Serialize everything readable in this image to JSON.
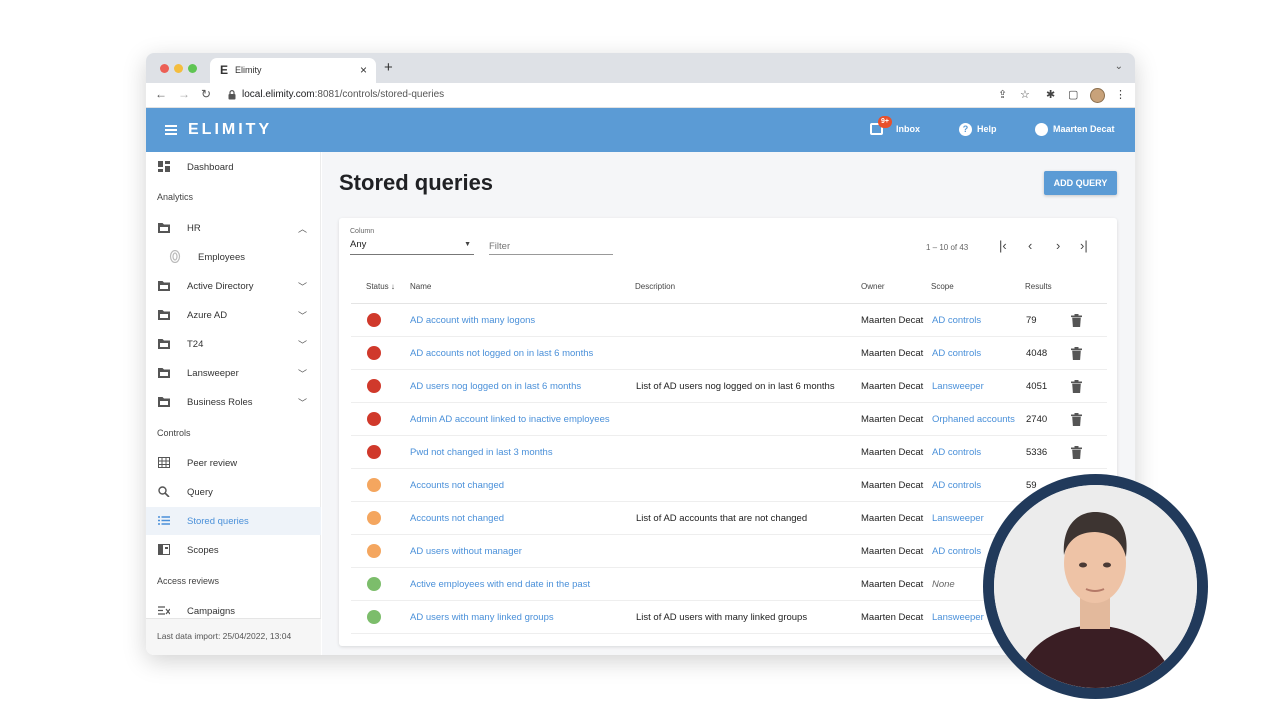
{
  "browser": {
    "tab_logo": "E",
    "tab_title": "Elimity",
    "tab_close": "×",
    "new_tab": "+",
    "tabs_menu": "⌄",
    "url_host": "local.elimity.com",
    "url_rest": ":8081/controls/stored-queries"
  },
  "appbar": {
    "brand": "ELIMITY",
    "inbox_badge": "9+",
    "inbox_label": "Inbox",
    "help_label": "Help",
    "user_label": "Maarten Decat"
  },
  "sidebar": {
    "dashboard": "Dashboard",
    "section_analytics": "Analytics",
    "hr": "HR",
    "employees": "Employees",
    "active_directory": "Active Directory",
    "azure_ad": "Azure AD",
    "t24": "T24",
    "lansweeper": "Lansweeper",
    "business_roles": "Business Roles",
    "section_controls": "Controls",
    "peer_review": "Peer review",
    "query": "Query",
    "stored_queries": "Stored queries",
    "scopes": "Scopes",
    "section_access_reviews": "Access reviews",
    "campaigns": "Campaigns",
    "footer": "Last data import: 25/04/2022, 13:04"
  },
  "main": {
    "title": "Stored queries",
    "add_button": "ADD QUERY",
    "column_label": "Column",
    "column_value": "Any",
    "filter_placeholder": "Filter",
    "pagination": "1 – 10 of 43"
  },
  "table": {
    "headers": {
      "status": "Status",
      "name": "Name",
      "description": "Description",
      "owner": "Owner",
      "scope": "Scope",
      "results": "Results"
    },
    "rows": [
      {
        "status_color": "#d0392b",
        "name": "AD account with many logons",
        "description": "",
        "owner": "Maarten Decat",
        "scope": "AD controls",
        "scope_none": false,
        "results": "79"
      },
      {
        "status_color": "#d0392b",
        "name": "AD accounts not logged on in last 6 months",
        "description": "",
        "owner": "Maarten Decat",
        "scope": "AD controls",
        "scope_none": false,
        "results": "4048"
      },
      {
        "status_color": "#d0392b",
        "name": "AD users nog logged on in last 6 months",
        "description": "List of AD users nog logged on in last 6 months",
        "owner": "Maarten Decat",
        "scope": "Lansweeper",
        "scope_none": false,
        "results": "4051"
      },
      {
        "status_color": "#d0392b",
        "name": "Admin AD account linked to inactive employees",
        "description": "",
        "owner": "Maarten Decat",
        "scope": "Orphaned accounts",
        "scope_none": false,
        "results": "2740"
      },
      {
        "status_color": "#d0392b",
        "name": "Pwd not changed in last 3 months",
        "description": "",
        "owner": "Maarten Decat",
        "scope": "AD controls",
        "scope_none": false,
        "results": "5336"
      },
      {
        "status_color": "#f4a65f",
        "name": "Accounts not changed",
        "description": "",
        "owner": "Maarten Decat",
        "scope": "AD controls",
        "scope_none": false,
        "results": "59"
      },
      {
        "status_color": "#f4a65f",
        "name": "Accounts not changed",
        "description": "List of AD accounts that are not changed",
        "owner": "Maarten Decat",
        "scope": "Lansweeper",
        "scope_none": false,
        "results": ""
      },
      {
        "status_color": "#f4a65f",
        "name": "AD users without manager",
        "description": "",
        "owner": "Maarten Decat",
        "scope": "AD controls",
        "scope_none": false,
        "results": ""
      },
      {
        "status_color": "#7cbd6b",
        "name": "Active employees with end date in the past",
        "description": "",
        "owner": "Maarten Decat",
        "scope": "None",
        "scope_none": true,
        "results": ""
      },
      {
        "status_color": "#7cbd6b",
        "name": "AD users with many linked groups",
        "description": "List of AD users with many linked groups",
        "owner": "Maarten Decat",
        "scope": "Lansweeper",
        "scope_none": false,
        "results": ""
      }
    ]
  },
  "colors": {
    "appbar": "#5b9bd5",
    "link": "#4a90d9",
    "status_red": "#d0392b",
    "status_orange": "#f4a65f",
    "status_green": "#7cbd6b",
    "cam_ring": "#213a5b"
  }
}
